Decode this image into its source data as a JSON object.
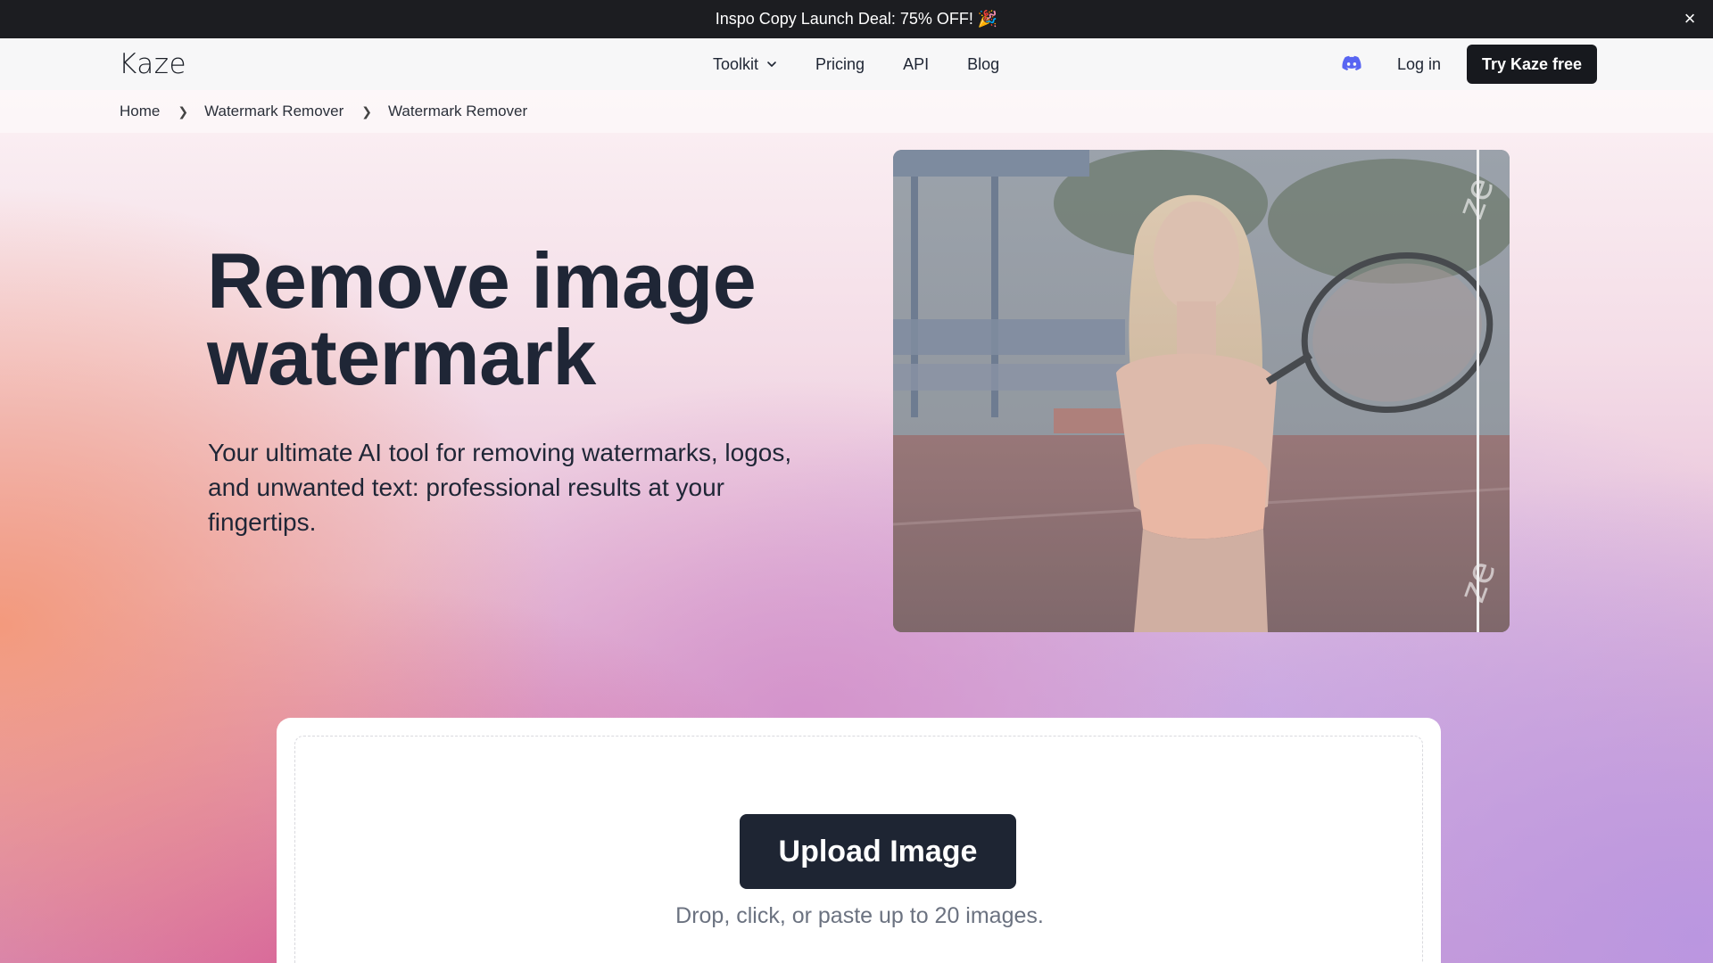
{
  "promo": {
    "text": "Inspo Copy Launch Deal: 75% OFF! 🎉",
    "close_icon": "×"
  },
  "nav": {
    "logo": "Kaze",
    "links": [
      {
        "label": "Toolkit",
        "has_dropdown": true
      },
      {
        "label": "Pricing"
      },
      {
        "label": "API"
      },
      {
        "label": "Blog"
      }
    ],
    "discord_icon": "discord-icon",
    "login": "Log in",
    "cta": "Try Kaze free"
  },
  "breadcrumb": {
    "items": [
      "Home",
      "Watermark Remover",
      "Watermark Remover"
    ]
  },
  "hero": {
    "title_line1": "Remove image",
    "title_line2": "watermark",
    "subtitle": "Your ultimate AI tool for removing watermarks, logos, and unwanted text: professional results at your fingertips."
  },
  "upload": {
    "button": "Upload Image",
    "hint": "Drop, click, or paste up to 20 images."
  },
  "colors": {
    "promo_bg": "#1c1d21",
    "cta_bg": "#17191e",
    "title": "#1f2636",
    "upload_btn": "#1e2533",
    "discord": "#5865f2"
  }
}
